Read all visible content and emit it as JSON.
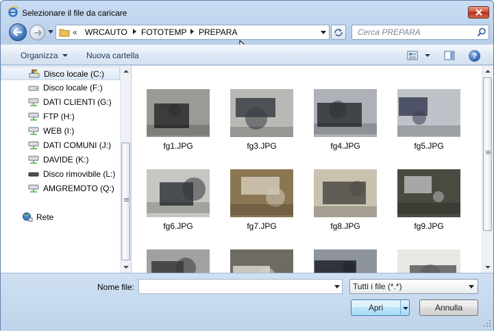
{
  "window": {
    "title": "Selezionare il file da caricare"
  },
  "address": {
    "overflow": "«",
    "crumbs": [
      "WRCAUTO",
      "FOTOTEMP",
      "PREPARA"
    ]
  },
  "search": {
    "placeholder": "Cerca PREPARA"
  },
  "toolbar": {
    "organize_label": "Organizza",
    "new_folder_label": "Nuova cartella",
    "help_label": "?"
  },
  "sidebar": {
    "items": [
      {
        "label": "Disco locale (C:)",
        "icon": "windows-drive-icon",
        "selected": true
      },
      {
        "label": "Disco locale (F:)",
        "icon": "hard-drive-icon"
      },
      {
        "label": "DATI CLIENTI (G:)",
        "icon": "network-drive-icon"
      },
      {
        "label": "FTP (H:)",
        "icon": "network-drive-icon"
      },
      {
        "label": "WEB (I:)",
        "icon": "network-drive-icon"
      },
      {
        "label": "DATI COMUNI (J:)",
        "icon": "network-drive-icon"
      },
      {
        "label": "DAVIDE (K:)",
        "icon": "network-drive-icon"
      },
      {
        "label": "Disco rimovibile (L:)",
        "icon": "removable-drive-icon"
      },
      {
        "label": "AMGREMOTO (Q:)",
        "icon": "network-drive-icon"
      }
    ],
    "network": {
      "label": "Rete",
      "icon": "network-icon"
    }
  },
  "files": [
    {
      "name": "fg1.JPG",
      "bg": "#9a9a96",
      "fg": "#2c2c2c"
    },
    {
      "name": "fg3.JPG",
      "bg": "#b8b8b4",
      "fg": "#3a3d44"
    },
    {
      "name": "fg4.JPG",
      "bg": "#aeb2b8",
      "fg": "#2e3136"
    },
    {
      "name": "fg5.JPG",
      "bg": "#bfc3c9",
      "fg": "#3a3f56"
    },
    {
      "name": "fg6.JPG",
      "bg": "#c6c6c2",
      "fg": "#34373c"
    },
    {
      "name": "fg7.JPG",
      "bg": "#8a7652",
      "fg": "#d0c9b7"
    },
    {
      "name": "fg8.JPG",
      "bg": "#c9c2b0",
      "fg": "#4d4b47"
    },
    {
      "name": "fg9.JPG",
      "bg": "#4b4a40",
      "fg": "#b5b8b6"
    },
    {
      "name": "",
      "bg": "#9fa1a3",
      "fg": "#3a3a3a"
    },
    {
      "name": "",
      "bg": "#6e6b62",
      "fg": "#d8d6cf"
    },
    {
      "name": "",
      "bg": "#8e949c",
      "fg": "#20232a"
    },
    {
      "name": "",
      "bg": "#e8e7e3",
      "fg": "#5a5a5a"
    }
  ],
  "bottom": {
    "filename_label": "Nome file:",
    "filename_value": "",
    "filter_value": "Tutti i file (*.*)",
    "open_label": "Apri",
    "cancel_label": "Annulla"
  }
}
